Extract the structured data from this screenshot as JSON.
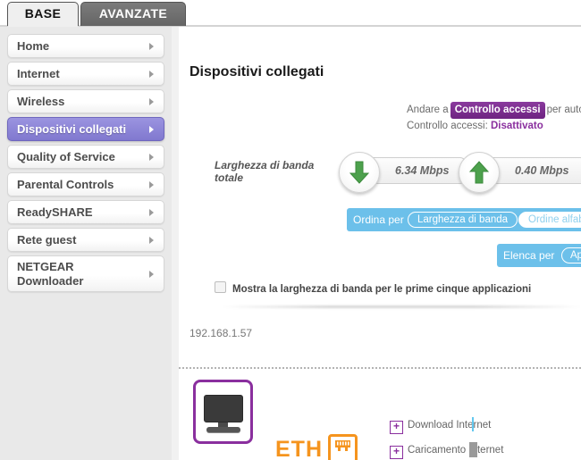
{
  "tabs": [
    {
      "label": "BASE",
      "active": true
    },
    {
      "label": "AVANZATE",
      "active": false
    }
  ],
  "sidebar": {
    "items": [
      {
        "label": "Home",
        "active": false
      },
      {
        "label": "Internet",
        "active": false
      },
      {
        "label": "Wireless",
        "active": false
      },
      {
        "label": "Dispositivi collegati",
        "active": true
      },
      {
        "label": "Quality of Service",
        "active": false
      },
      {
        "label": "Parental Controls",
        "active": false
      },
      {
        "label": "ReadySHARE",
        "active": false
      },
      {
        "label": "Rete guest",
        "active": false
      },
      {
        "label": "NETGEAR\nDownloader",
        "active": false
      }
    ]
  },
  "main": {
    "page_title": "Dispositivi collegati",
    "access": {
      "prefix": "Andare a",
      "button_label": "Controllo accessi",
      "suffix": "per autor",
      "status_label": "Controllo accessi:",
      "status_value": "Disattivato"
    },
    "bandwidth": {
      "label": "Larghezza di banda totale",
      "download_value": "6.34 Mbps",
      "upload_value": "0.40 Mbps",
      "down_icon": "arrow-down-icon",
      "up_icon": "arrow-up-icon",
      "arrow_color": "#4da14d"
    },
    "sort": {
      "label": "Ordina per",
      "selected_option": "Larghezza di banda",
      "other_option": "Ordine alfabe",
      "bar_color": "#6cc0ea"
    },
    "list": {
      "label": "Elenca per",
      "option": "Ap"
    },
    "show_top_apps": {
      "label": "Mostra la larghezza di banda per le prime cinque applicazioni",
      "checked": false
    },
    "ip_address": "192.168.1.57",
    "device": {
      "icon": "desktop-monitor-icon",
      "border_color": "#8a2f9e",
      "connection_badge": "ETH",
      "connection_icon": "ethernet-jack-icon",
      "badge_color": "#f5941e",
      "traffic": [
        {
          "label": "Download Internet",
          "expander": "+"
        },
        {
          "label": "Caricamento Internet",
          "expander": "+"
        }
      ]
    }
  }
}
